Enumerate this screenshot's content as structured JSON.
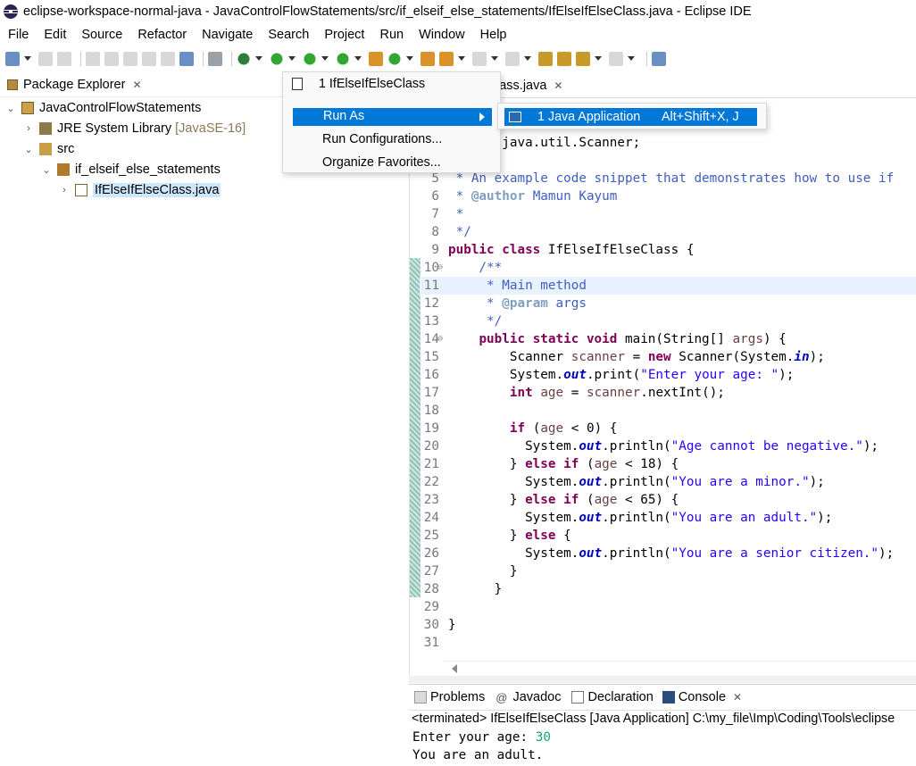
{
  "window": {
    "title": "eclipse-workspace-normal-java - JavaControlFlowStatements/src/if_elseif_else_statements/IfElseIfElseClass.java - Eclipse IDE"
  },
  "menubar": [
    "File",
    "Edit",
    "Source",
    "Refactor",
    "Navigate",
    "Search",
    "Project",
    "Run",
    "Window",
    "Help"
  ],
  "package_explorer": {
    "title": "Package Explorer",
    "tree": [
      {
        "label": "JavaControlFlowStatements",
        "level": 0,
        "expanded": true
      },
      {
        "label": "JRE System Library",
        "suffix": "[JavaSE-16]",
        "level": 1,
        "expanded": false
      },
      {
        "label": "src",
        "level": 1,
        "expanded": true
      },
      {
        "label": "if_elseif_else_statements",
        "level": 2,
        "expanded": true
      },
      {
        "label": "IfElseIfElseClass.java",
        "level": 3,
        "expanded": false,
        "selected": true
      }
    ]
  },
  "editor": {
    "tab_label": "lass.java",
    "lines": [
      {
        "n": "",
        "t": "java.util.Scanner;"
      },
      {
        "n": "5",
        "t": " * An example code snippet that demonstrates how to use if"
      },
      {
        "n": "6",
        "t": " * @author Mamun Kayum"
      },
      {
        "n": "7",
        "t": " *"
      },
      {
        "n": "8",
        "t": " */"
      },
      {
        "n": "9",
        "t": "public class IfElseIfElseClass {"
      },
      {
        "n": "10",
        "t": "    /**"
      },
      {
        "n": "11",
        "t": "     * Main method"
      },
      {
        "n": "12",
        "t": "     * @param args"
      },
      {
        "n": "13",
        "t": "     */"
      },
      {
        "n": "14",
        "t": "    public static void main(String[] args) {"
      },
      {
        "n": "15",
        "t": "        Scanner scanner = new Scanner(System.in);"
      },
      {
        "n": "16",
        "t": "        System.out.print(\"Enter your age: \");"
      },
      {
        "n": "17",
        "t": "        int age = scanner.nextInt();"
      },
      {
        "n": "18",
        "t": ""
      },
      {
        "n": "19",
        "t": "        if (age < 0) {"
      },
      {
        "n": "20",
        "t": "          System.out.println(\"Age cannot be negative.\");"
      },
      {
        "n": "21",
        "t": "        } else if (age < 18) {"
      },
      {
        "n": "22",
        "t": "          System.out.println(\"You are a minor.\");"
      },
      {
        "n": "23",
        "t": "        } else if (age < 65) {"
      },
      {
        "n": "24",
        "t": "          System.out.println(\"You are an adult.\");"
      },
      {
        "n": "25",
        "t": "        } else {"
      },
      {
        "n": "26",
        "t": "          System.out.println(\"You are a senior citizen.\");"
      },
      {
        "n": "27",
        "t": "        }"
      },
      {
        "n": "28",
        "t": "      }"
      },
      {
        "n": "29",
        "t": ""
      },
      {
        "n": "30",
        "t": "}"
      },
      {
        "n": "31",
        "t": ""
      }
    ]
  },
  "run_menu": {
    "recent": "1 IfElseIfElseClass",
    "run_as": "Run As",
    "run_configurations": "Run Configurations...",
    "organize_favorites": "Organize Favorites..."
  },
  "run_as_submenu": {
    "item": "1 Java Application",
    "shortcut": "Alt+Shift+X, J"
  },
  "console_view": {
    "tabs": [
      "Problems",
      "Javadoc",
      "Declaration",
      "Console"
    ],
    "status": "<terminated> IfElseIfElseClass [Java Application] C:\\my_file\\Imp\\Coding\\Tools\\eclipse",
    "output": [
      {
        "prompt": "Enter your age: ",
        "input": "30"
      },
      {
        "prompt": "You are an adult.",
        "input": ""
      }
    ]
  },
  "colors": {
    "keyword": "#7f0055",
    "comment": "#3f5fbf",
    "string": "#2a00ff",
    "selection": "#0078d7",
    "console_input": "#1aa56e"
  }
}
